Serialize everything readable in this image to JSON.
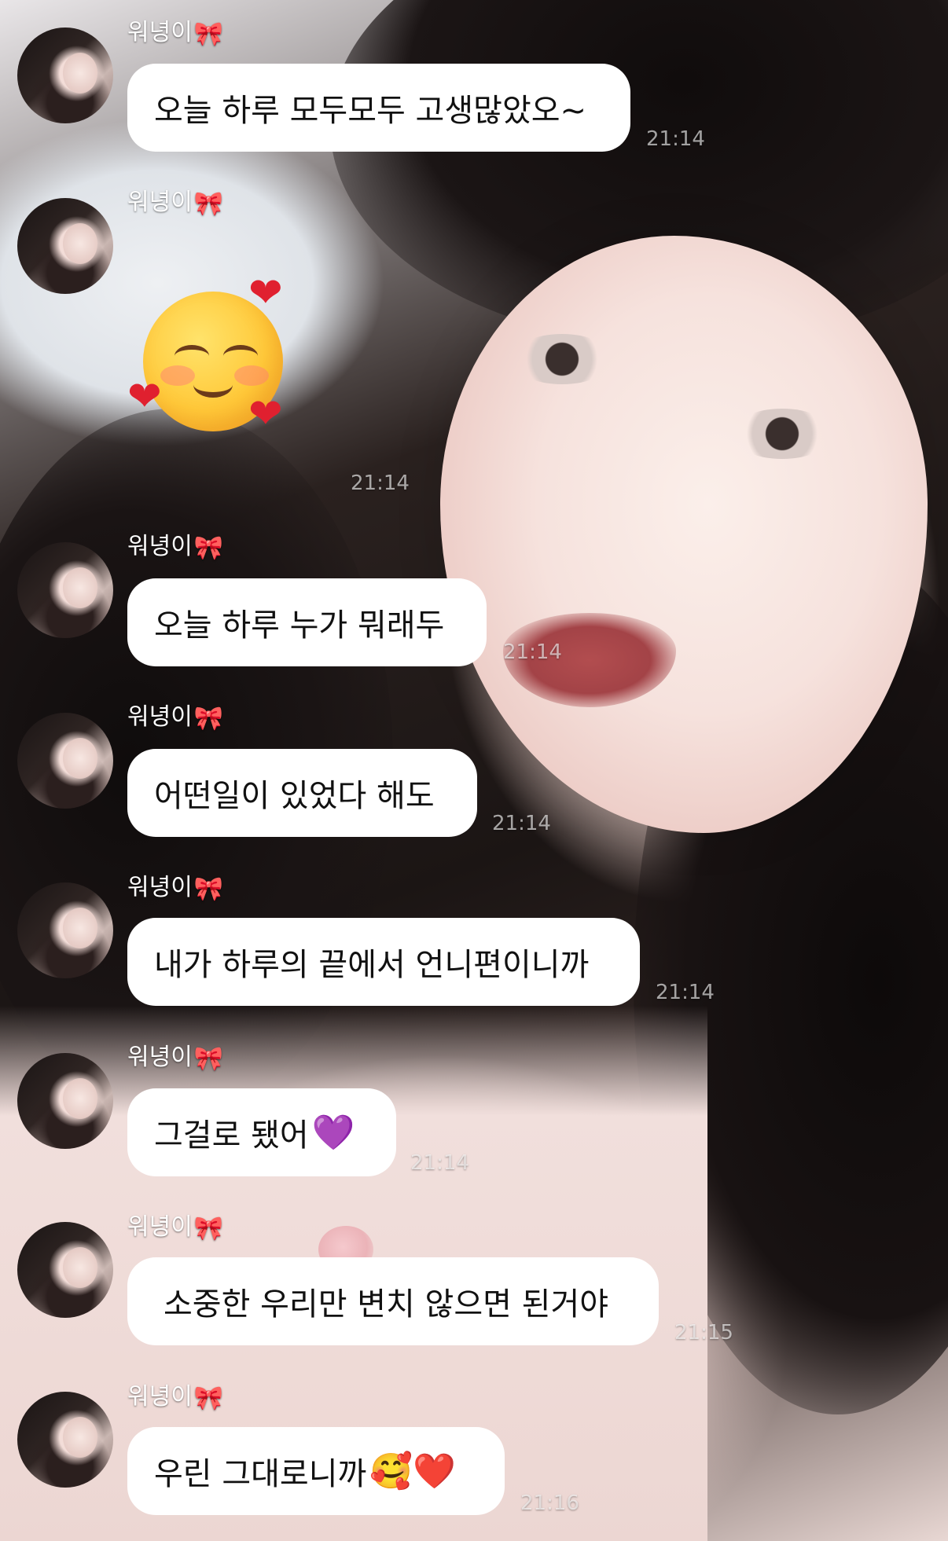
{
  "chat": {
    "messages": [
      {
        "sender": "워녕이",
        "text": "오늘 하루 모두모두 고생많았오~",
        "time": "21:14"
      },
      {
        "sender": "워녕이",
        "sticker": "smiling-face-with-hearts-sticker",
        "time": "21:14"
      },
      {
        "sender": "워녕이",
        "text": "오늘 하루 누가 뭐래두",
        "time": "21:14"
      },
      {
        "sender": "워녕이",
        "text": "어떤일이 있었다 해도",
        "time": "21:14"
      },
      {
        "sender": "워녕이",
        "text": "내가 하루의 끝에서 언니편이니까",
        "time": "21:14"
      },
      {
        "sender": "워녕이",
        "text": "그걸로 됐어",
        "emoji": "💜",
        "time": "21:14"
      },
      {
        "sender": "워녕이",
        "text": "소중한 우리만 변치 않으면 된거야",
        "time": "21:15"
      },
      {
        "sender": "워녕이",
        "text": "우린 그대로니까",
        "emoji": "🥰❤️",
        "time": "21:16"
      }
    ],
    "bow_emoji": "🎀"
  },
  "colors": {
    "bubble": "#ffffff",
    "text": "#111111",
    "sender": "#ffffff"
  }
}
